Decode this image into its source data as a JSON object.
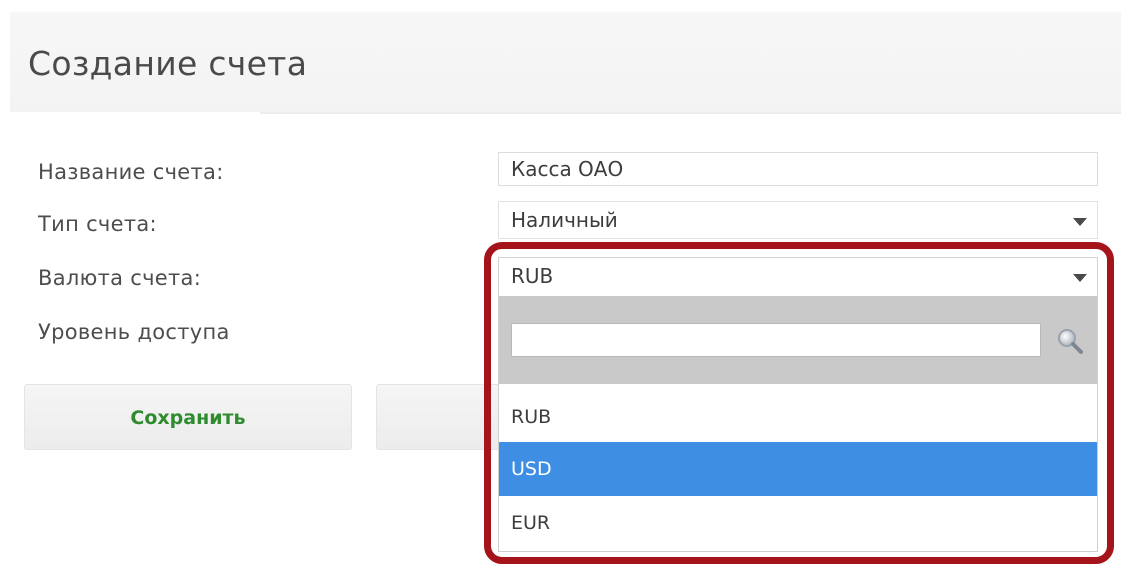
{
  "header": {
    "title": "Создание счета"
  },
  "form": {
    "name_label": "Название счета:",
    "name_value": "Касса ОАО",
    "type_label": "Тип счета:",
    "type_value": "Наличный",
    "currency_label": "Валюта счета:",
    "currency_value": "RUB",
    "access_label": "Уровень доступа"
  },
  "buttons": {
    "save_label": "Сохранить",
    "second_label": ""
  },
  "dropdown": {
    "search_value": "",
    "options": [
      {
        "label": "RUB",
        "selected": false
      },
      {
        "label": "USD",
        "selected": true
      },
      {
        "label": "EUR",
        "selected": false
      }
    ]
  },
  "icons": {
    "search": "search-icon",
    "caret": "chevron-down-icon"
  },
  "colors": {
    "save_text": "#2e8b2e",
    "selected_option": "#3e8ee4",
    "highlight_frame": "#a5141b"
  }
}
